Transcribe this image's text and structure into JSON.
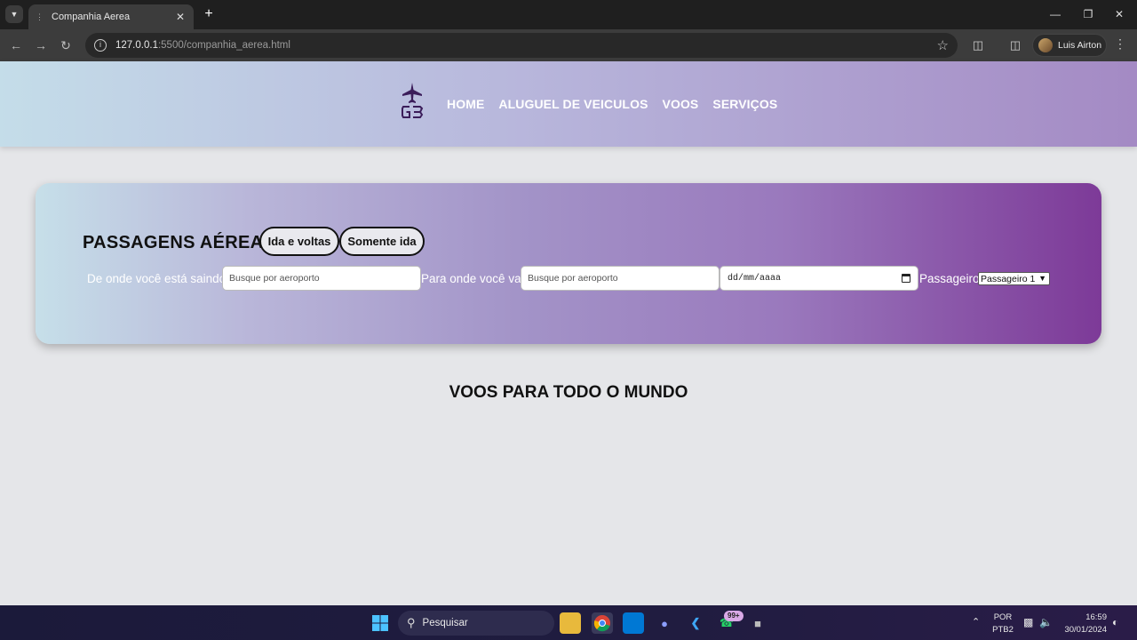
{
  "browser": {
    "tab_title": "Companhia Aerea",
    "new_tab": "+",
    "url_host": "127.0.0.1",
    "url_path": ":5500/companhia_aerea.html",
    "profile_name": "Luis Airton"
  },
  "nav": {
    "items": [
      {
        "label": "HOME"
      },
      {
        "label": "ALUGUEL DE VEICULOS"
      },
      {
        "label": "VOOS"
      },
      {
        "label": "SERVIÇOS"
      }
    ]
  },
  "search": {
    "title": "PASSAGENS AÉREAS",
    "trip_options": [
      "Ida e voltas",
      "Somente ida"
    ],
    "origin_label": "De onde você está saindo?",
    "origin_placeholder": "Busque por aeroporto",
    "destination_label": "Para onde você vai?",
    "destination_placeholder": "Busque por aeroporto",
    "date_value": "dd/mm/aaaa",
    "passengers_label": "Passageiros",
    "passengers_selected": "Passageiro 1"
  },
  "section_title": "VOOS PARA TODO O MUNDO",
  "taskbar": {
    "search_text": "Pesquisar",
    "notification_badge": "99+",
    "language_line1": "POR",
    "language_line2": "PTB2",
    "time": "16:59",
    "date": "30/01/2024"
  },
  "colors": {
    "header_gradient": [
      "#c4dde9",
      "#b8b7dc",
      "#a48ac4"
    ],
    "card_gradient_end": "#7d3a98",
    "logo_color": "#3b1d5a"
  }
}
